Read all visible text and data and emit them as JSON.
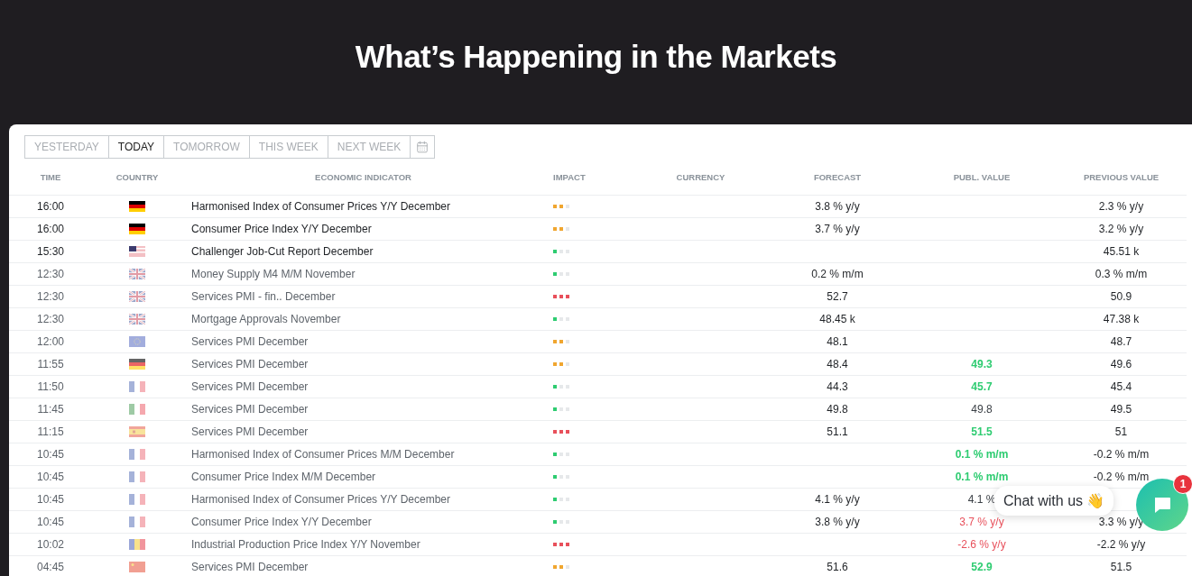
{
  "title": "What’s Happening in the Markets",
  "tabs": [
    {
      "label": "YESTERDAY",
      "selected": false
    },
    {
      "label": "TODAY",
      "selected": true
    },
    {
      "label": "TOMORROW",
      "selected": false
    },
    {
      "label": "THIS WEEK",
      "selected": false
    },
    {
      "label": "NEXT WEEK",
      "selected": false
    }
  ],
  "columns": [
    "TIME",
    "COUNTRY",
    "ECONOMIC INDICATOR",
    "IMPACT",
    "CURRENCY",
    "FORECAST",
    "PUBL. VALUE",
    "PREVIOUS VALUE"
  ],
  "rows": [
    {
      "time": "16:00",
      "flag": {
        "kind": "de"
      },
      "indicator": "Harmonised Index of Consumer Prices Y/Y December",
      "impact": {
        "stars": 2
      },
      "forecast": "3.8 % y/y",
      "previous": "2.3 % y/y",
      "upcoming": true
    },
    {
      "time": "16:00",
      "flag": {
        "kind": "de"
      },
      "indicator": "Consumer Price Index Y/Y December",
      "impact": {
        "stars": 2
      },
      "forecast": "3.7 % y/y",
      "previous": "3.2 % y/y",
      "upcoming": true
    },
    {
      "time": "15:30",
      "flag": {
        "kind": "us"
      },
      "indicator": "Challenger Job-Cut Report December",
      "impact": {
        "stars": 1
      },
      "previous": "45.51 k",
      "upcoming": true
    },
    {
      "time": "12:30",
      "flag": {
        "kind": "gb"
      },
      "indicator": "Money Supply M4 M/M November",
      "impact": {
        "stars": 1
      },
      "forecast": "0.2 % m/m",
      "previous": "0.3 % m/m",
      "upcoming": false
    },
    {
      "time": "12:30",
      "flag": {
        "kind": "gb"
      },
      "indicator": "Services PMI - fin.. December",
      "impact": {
        "stars": 3
      },
      "forecast": "52.7",
      "previous": "50.9",
      "upcoming": false
    },
    {
      "time": "12:30",
      "flag": {
        "kind": "gb"
      },
      "indicator": "Mortgage Approvals November",
      "impact": {
        "stars": 1
      },
      "forecast": "48.45 k",
      "previous": "47.38 k",
      "upcoming": false
    },
    {
      "time": "12:00",
      "flag": {
        "kind": "eu"
      },
      "indicator": "Services PMI December",
      "impact": {
        "stars": 2
      },
      "forecast": "48.1",
      "previous": "48.7",
      "upcoming": false
    },
    {
      "time": "11:55",
      "flag": {
        "kind": "de"
      },
      "indicator": "Services PMI December",
      "impact": {
        "stars": 2
      },
      "forecast": "48.4",
      "published": {
        "value": "49.3",
        "color": "#2ecc71"
      },
      "previous": "49.6",
      "upcoming": false
    },
    {
      "time": "11:50",
      "flag": {
        "kind": "fr"
      },
      "indicator": "Services PMI December",
      "impact": {
        "stars": 1
      },
      "forecast": "44.3",
      "published": {
        "value": "45.7",
        "color": "#2ecc71"
      },
      "previous": "45.4",
      "upcoming": false
    },
    {
      "time": "11:45",
      "flag": {
        "kind": "it"
      },
      "indicator": "Services PMI December",
      "impact": {
        "stars": 1
      },
      "forecast": "49.8",
      "published": {
        "value": "49.8",
        "color": "#3a3f45"
      },
      "previous": "49.5",
      "upcoming": false
    },
    {
      "time": "11:15",
      "flag": {
        "kind": "es"
      },
      "indicator": "Services PMI December",
      "impact": {
        "stars": 3
      },
      "forecast": "51.1",
      "published": {
        "value": "51.5",
        "color": "#2ecc71"
      },
      "previous": "51",
      "upcoming": false
    },
    {
      "time": "10:45",
      "flag": {
        "kind": "fr"
      },
      "indicator": "Harmonised Index of Consumer Prices M/M December",
      "impact": {
        "stars": 1
      },
      "published": {
        "value": "0.1 % m/m",
        "color": "#2ecc71"
      },
      "previous": "-0.2 % m/m",
      "upcoming": false
    },
    {
      "time": "10:45",
      "flag": {
        "kind": "fr"
      },
      "indicator": "Consumer Price Index M/M December",
      "impact": {
        "stars": 1
      },
      "published": {
        "value": "0.1 % m/m",
        "color": "#2ecc71"
      },
      "previous": "-0.2 % m/m",
      "upcoming": false
    },
    {
      "time": "10:45",
      "flag": {
        "kind": "fr"
      },
      "indicator": "Harmonised Index of Consumer Prices Y/Y December",
      "impact": {
        "stars": 1
      },
      "forecast": "4.1 % y/y",
      "published": {
        "value": "4.1 %",
        "color": "#3a3f45"
      },
      "upcoming": false
    },
    {
      "time": "10:45",
      "flag": {
        "kind": "fr"
      },
      "indicator": "Consumer Price Index Y/Y December",
      "impact": {
        "stars": 1
      },
      "forecast": "3.8 % y/y",
      "published": {
        "value": "3.7 % y/y",
        "color": "#e8505b"
      },
      "previous": "3.3 % y/y",
      "upcoming": false
    },
    {
      "time": "10:02",
      "flag": {
        "kind": "ro"
      },
      "indicator": "Industrial Production Price Index Y/Y November",
      "impact": {
        "stars": 3
      },
      "published": {
        "value": "-2.6 % y/y",
        "color": "#e8505b"
      },
      "previous": "-2.2 % y/y",
      "upcoming": false
    },
    {
      "time": "04:45",
      "flag": {
        "kind": "cn"
      },
      "indicator": "Services PMI December",
      "impact": {
        "stars": 2
      },
      "forecast": "51.6",
      "published": {
        "value": "52.9",
        "color": "#2ecc71"
      },
      "previous": "51.5",
      "upcoming": false
    }
  ],
  "chat": {
    "label": "Chat with us 👋",
    "badge": "1"
  }
}
